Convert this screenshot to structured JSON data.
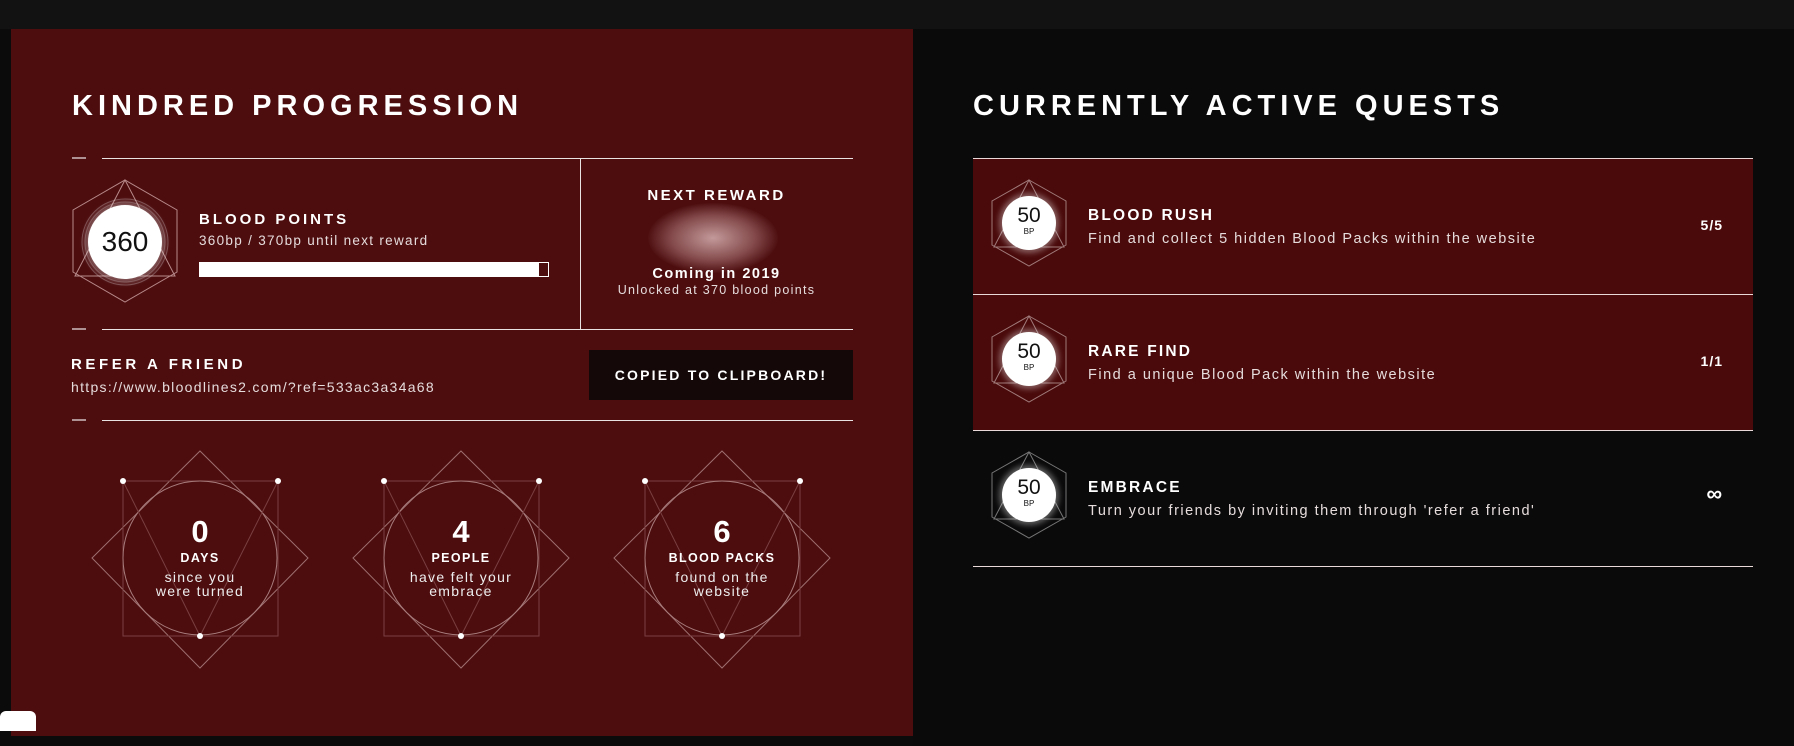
{
  "progression": {
    "title": "KINDRED PROGRESSION",
    "blood_points": {
      "value": "360",
      "label": "BLOOD POINTS",
      "subtitle": "360bp / 370bp until next reward",
      "progress_current": 360,
      "progress_target": 370
    },
    "next_reward": {
      "label": "NEXT REWARD",
      "status": "Coming in 2019",
      "unlock_text": "Unlocked at 370 blood points"
    },
    "refer": {
      "label": "REFER A FRIEND",
      "url": "https://www.bloodlines2.com/?ref=533ac3a34a68",
      "button_label": "COPIED TO CLIPBOARD!"
    },
    "stats": [
      {
        "value": "0",
        "unit": "DAYS",
        "line1": "since you",
        "line2": "were turned"
      },
      {
        "value": "4",
        "unit": "PEOPLE",
        "line1": "have felt your",
        "line2": "embrace"
      },
      {
        "value": "6",
        "unit": "BLOOD PACKS",
        "line1": "found on the",
        "line2": "website"
      }
    ]
  },
  "quests": {
    "title": "CURRENTLY ACTIVE QUESTS",
    "items": [
      {
        "points": "50",
        "unit": "BP",
        "name": "BLOOD RUSH",
        "description": "Find and collect 5 hidden Blood Packs within the website",
        "progress": "5/5",
        "completed": true
      },
      {
        "points": "50",
        "unit": "BP",
        "name": "RARE FIND",
        "description": "Find a unique Blood Pack within the website",
        "progress": "1/1",
        "completed": true
      },
      {
        "points": "50",
        "unit": "BP",
        "name": "EMBRACE",
        "description": "Turn your friends by inviting them through 'refer a friend'",
        "progress": "∞",
        "completed": false
      }
    ]
  },
  "colors": {
    "panel_red": "#4d0d0f",
    "quest_active": "#4a0a0b",
    "background": "#0a0a0b",
    "button_bg": "#140809"
  }
}
